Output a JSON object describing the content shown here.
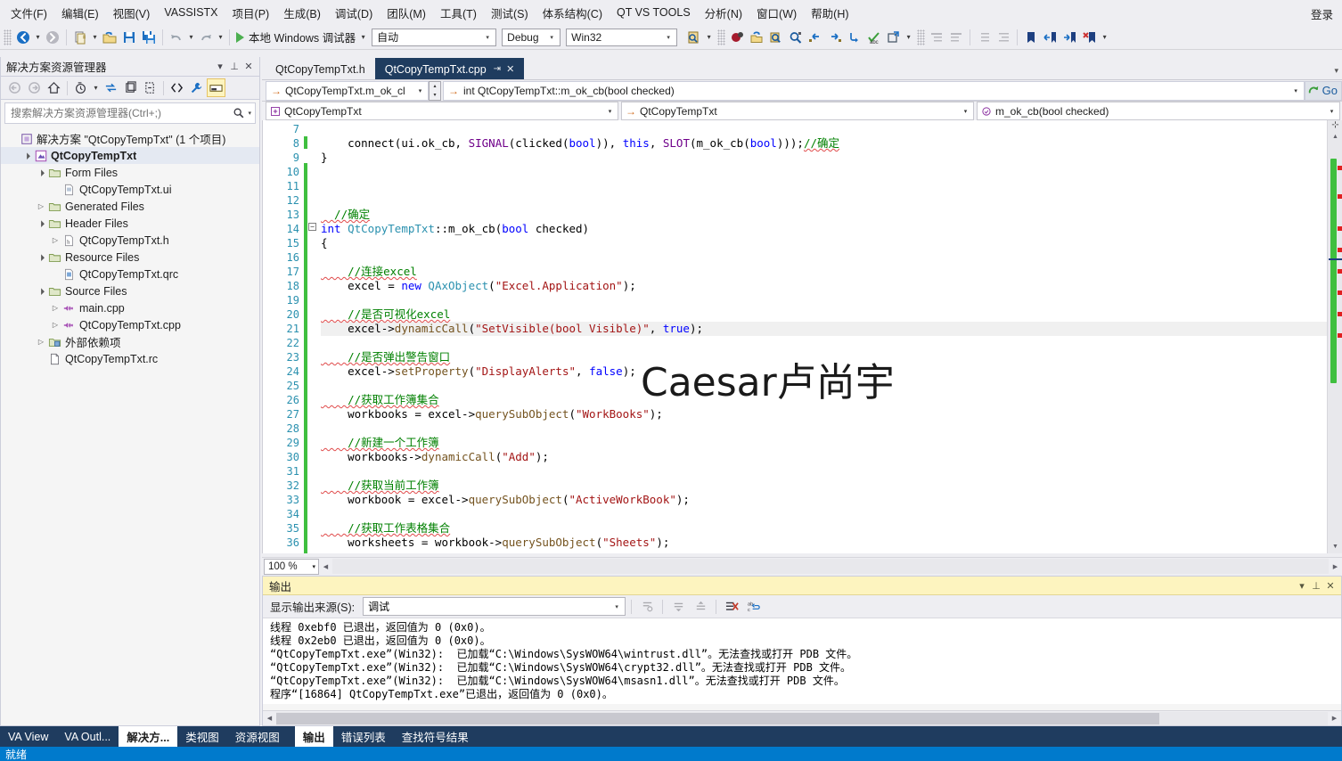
{
  "menubar": {
    "items": [
      {
        "label": "文件(F)",
        "name": "menu-file"
      },
      {
        "label": "编辑(E)",
        "name": "menu-edit"
      },
      {
        "label": "视图(V)",
        "name": "menu-view"
      },
      {
        "label": "VASSISTX",
        "name": "menu-vassistx"
      },
      {
        "label": "项目(P)",
        "name": "menu-project"
      },
      {
        "label": "生成(B)",
        "name": "menu-build"
      },
      {
        "label": "调试(D)",
        "name": "menu-debug"
      },
      {
        "label": "团队(M)",
        "name": "menu-team"
      },
      {
        "label": "工具(T)",
        "name": "menu-tools"
      },
      {
        "label": "测试(S)",
        "name": "menu-test"
      },
      {
        "label": "体系结构(C)",
        "name": "menu-architecture"
      },
      {
        "label": "QT VS TOOLS",
        "name": "menu-qt-vs-tools"
      },
      {
        "label": "分析(N)",
        "name": "menu-analyze"
      },
      {
        "label": "窗口(W)",
        "name": "menu-window"
      },
      {
        "label": "帮助(H)",
        "name": "menu-help"
      }
    ],
    "signin_label": "登录"
  },
  "toolbar": {
    "navigate_back": "navigate-backward-icon",
    "navigate_forward": "navigate-forward-icon",
    "new_project": "new-project-icon",
    "open_file": "open-file-icon",
    "save": "save-icon",
    "save_all": "save-all-icon",
    "undo": "undo-icon",
    "redo": "redo-icon",
    "run_label": "本地 Windows 调试器",
    "config_value": "自动",
    "build_config_value": "Debug",
    "platform_value": "Win32",
    "accent_green": "#4caf50"
  },
  "solution_explorer": {
    "title": "解决方案资源管理器",
    "search_placeholder": "搜索解决方案资源管理器(Ctrl+;)",
    "tree": [
      {
        "label": "解决方案 \"QtCopyTempTxt\" (1 个项目)",
        "depth": 0,
        "expander": "",
        "icon": "solution-icon",
        "bold": false,
        "name": "tree-item-solution"
      },
      {
        "label": "QtCopyTempTxt",
        "depth": 1,
        "expander": "▲",
        "icon": "project-icon",
        "bold": true,
        "name": "tree-item-project"
      },
      {
        "label": "Form Files",
        "depth": 2,
        "expander": "▲",
        "icon": "folder-icon",
        "bold": false,
        "name": "tree-item-form-files"
      },
      {
        "label": "QtCopyTempTxt.ui",
        "depth": 3,
        "expander": "",
        "icon": "ui-file-icon",
        "bold": false,
        "name": "tree-item-ui-file"
      },
      {
        "label": "Generated Files",
        "depth": 2,
        "expander": "▶",
        "icon": "folder-icon",
        "bold": false,
        "name": "tree-item-generated-files"
      },
      {
        "label": "Header Files",
        "depth": 2,
        "expander": "▲",
        "icon": "folder-icon",
        "bold": false,
        "name": "tree-item-header-files"
      },
      {
        "label": "QtCopyTempTxt.h",
        "depth": 3,
        "expander": "▶",
        "icon": "h-file-icon",
        "bold": false,
        "name": "tree-item-header-file"
      },
      {
        "label": "Resource Files",
        "depth": 2,
        "expander": "▲",
        "icon": "folder-icon",
        "bold": false,
        "name": "tree-item-resource-files"
      },
      {
        "label": "QtCopyTempTxt.qrc",
        "depth": 3,
        "expander": "",
        "icon": "qrc-file-icon",
        "bold": false,
        "name": "tree-item-qrc-file"
      },
      {
        "label": "Source Files",
        "depth": 2,
        "expander": "▲",
        "icon": "folder-icon",
        "bold": false,
        "name": "tree-item-source-files"
      },
      {
        "label": "main.cpp",
        "depth": 3,
        "expander": "▶",
        "icon": "cpp-file-icon",
        "bold": false,
        "name": "tree-item-main-cpp"
      },
      {
        "label": "QtCopyTempTxt.cpp",
        "depth": 3,
        "expander": "▶",
        "icon": "cpp-file-icon",
        "bold": false,
        "name": "tree-item-project-cpp"
      },
      {
        "label": "外部依赖项",
        "depth": 2,
        "expander": "▶",
        "icon": "external-deps-icon",
        "bold": false,
        "name": "tree-item-external-deps"
      },
      {
        "label": "QtCopyTempTxt.rc",
        "depth": 2,
        "expander": "",
        "icon": "rc-file-icon",
        "bold": false,
        "name": "tree-item-rc-file"
      }
    ]
  },
  "editor": {
    "tabs": [
      {
        "label": "QtCopyTempTxt.h",
        "active": false,
        "name": "tab-header"
      },
      {
        "label": "QtCopyTempTxt.cpp",
        "active": true,
        "pin": "⇥",
        "close": "✕",
        "name": "tab-source"
      }
    ],
    "navbar": {
      "member_combo": "QtCopyTempTxt.m_ok_cl",
      "signature": "int QtCopyTempTxt::m_ok_cb(bool checked)",
      "go_label": "Go"
    },
    "navbar2": {
      "class_combo": "QtCopyTempTxt",
      "scope_combo": "QtCopyTempTxt",
      "member_combo": "m_ok_cb(bool checked)"
    },
    "watermark": "Caesar卢尚宇",
    "zoom_level": "100 %",
    "first_line": 7,
    "lines": [
      {
        "n": 7,
        "segs": []
      },
      {
        "n": 8,
        "segs": [
          {
            "t": "    ",
            "c": ""
          },
          {
            "t": "connect",
            "c": ""
          },
          {
            "t": "(ui.ok_cb, ",
            "c": ""
          },
          {
            "t": "SIGNAL",
            "c": "mac"
          },
          {
            "t": "(clicked(",
            "c": ""
          },
          {
            "t": "bool",
            "c": "kw"
          },
          {
            "t": ")), ",
            "c": ""
          },
          {
            "t": "this",
            "c": "kw"
          },
          {
            "t": ", ",
            "c": ""
          },
          {
            "t": "SLOT",
            "c": "mac"
          },
          {
            "t": "(m_ok_cb(",
            "c": ""
          },
          {
            "t": "bool",
            "c": "kw"
          },
          {
            "t": ")));",
            "c": ""
          },
          {
            "t": "//确定",
            "c": "cm squig"
          }
        ]
      },
      {
        "n": 9,
        "segs": [
          {
            "t": "}",
            "c": ""
          }
        ]
      },
      {
        "n": 10,
        "segs": []
      },
      {
        "n": 11,
        "segs": []
      },
      {
        "n": 12,
        "segs": []
      },
      {
        "n": 13,
        "segs": [
          {
            "t": "  //确定",
            "c": "cm squig"
          }
        ]
      },
      {
        "n": 14,
        "segs": [
          {
            "t": "int",
            "c": "kw"
          },
          {
            "t": " ",
            "c": ""
          },
          {
            "t": "QtCopyTempTxt",
            "c": "cls2"
          },
          {
            "t": "::",
            "c": ""
          },
          {
            "t": "m_ok_cb",
            "c": ""
          },
          {
            "t": "(",
            "c": ""
          },
          {
            "t": "bool",
            "c": "kw"
          },
          {
            "t": " checked)",
            "c": ""
          }
        ]
      },
      {
        "n": 15,
        "segs": [
          {
            "t": "{",
            "c": ""
          }
        ]
      },
      {
        "n": 16,
        "segs": []
      },
      {
        "n": 17,
        "segs": [
          {
            "t": "    //连接excel",
            "c": "cm squig"
          }
        ]
      },
      {
        "n": 18,
        "segs": [
          {
            "t": "    excel = ",
            "c": ""
          },
          {
            "t": "new",
            "c": "kw"
          },
          {
            "t": " ",
            "c": ""
          },
          {
            "t": "QAxObject",
            "c": "cls2"
          },
          {
            "t": "(",
            "c": ""
          },
          {
            "t": "\"Excel.Application\"",
            "c": "str"
          },
          {
            "t": ");",
            "c": ""
          }
        ]
      },
      {
        "n": 19,
        "segs": []
      },
      {
        "n": 20,
        "segs": [
          {
            "t": "    //是否可视化excel",
            "c": "cm squig"
          }
        ]
      },
      {
        "n": 21,
        "segs": [
          {
            "t": "    excel->",
            "c": ""
          },
          {
            "t": "dynamicCall",
            "c": "fn"
          },
          {
            "t": "(",
            "c": ""
          },
          {
            "t": "\"SetVisible(bool Visible)\"",
            "c": "str"
          },
          {
            "t": ", ",
            "c": ""
          },
          {
            "t": "true",
            "c": "kw"
          },
          {
            "t": ");",
            "c": ""
          }
        ],
        "hl": true
      },
      {
        "n": 22,
        "segs": []
      },
      {
        "n": 23,
        "segs": [
          {
            "t": "    //是否弹出警告窗口",
            "c": "cm squig"
          }
        ]
      },
      {
        "n": 24,
        "segs": [
          {
            "t": "    excel->",
            "c": ""
          },
          {
            "t": "setProperty",
            "c": "fn"
          },
          {
            "t": "(",
            "c": ""
          },
          {
            "t": "\"DisplayAlerts\"",
            "c": "str"
          },
          {
            "t": ", ",
            "c": ""
          },
          {
            "t": "false",
            "c": "kw"
          },
          {
            "t": ");",
            "c": ""
          }
        ]
      },
      {
        "n": 25,
        "segs": []
      },
      {
        "n": 26,
        "segs": [
          {
            "t": "    //获取工作簿集合",
            "c": "cm squig"
          }
        ]
      },
      {
        "n": 27,
        "segs": [
          {
            "t": "    workbooks = excel->",
            "c": ""
          },
          {
            "t": "querySubObject",
            "c": "fn"
          },
          {
            "t": "(",
            "c": ""
          },
          {
            "t": "\"WorkBooks\"",
            "c": "str"
          },
          {
            "t": ");",
            "c": ""
          }
        ]
      },
      {
        "n": 28,
        "segs": []
      },
      {
        "n": 29,
        "segs": [
          {
            "t": "    //新建一个工作簿",
            "c": "cm squig"
          }
        ]
      },
      {
        "n": 30,
        "segs": [
          {
            "t": "    workbooks->",
            "c": ""
          },
          {
            "t": "dynamicCall",
            "c": "fn"
          },
          {
            "t": "(",
            "c": ""
          },
          {
            "t": "\"Add\"",
            "c": "str"
          },
          {
            "t": ");",
            "c": ""
          }
        ]
      },
      {
        "n": 31,
        "segs": []
      },
      {
        "n": 32,
        "segs": [
          {
            "t": "    //获取当前工作簿",
            "c": "cm squig"
          }
        ]
      },
      {
        "n": 33,
        "segs": [
          {
            "t": "    workbook = excel->",
            "c": ""
          },
          {
            "t": "querySubObject",
            "c": "fn"
          },
          {
            "t": "(",
            "c": ""
          },
          {
            "t": "\"ActiveWorkBook\"",
            "c": "str"
          },
          {
            "t": ");",
            "c": ""
          }
        ]
      },
      {
        "n": 34,
        "segs": []
      },
      {
        "n": 35,
        "segs": [
          {
            "t": "    //获取工作表格集合",
            "c": "cm squig"
          }
        ]
      },
      {
        "n": 36,
        "segs": [
          {
            "t": "    worksheets = workbook->",
            "c": ""
          },
          {
            "t": "querySubObject",
            "c": "fn"
          },
          {
            "t": "(",
            "c": ""
          },
          {
            "t": "\"Sheets\"",
            "c": "str"
          },
          {
            "t": ");",
            "c": ""
          }
        ]
      }
    ]
  },
  "output": {
    "title": "输出",
    "source_label": "显示输出来源(S):",
    "source_value": "调试",
    "lines": [
      "线程 0xebf0 已退出，返回值为 0 (0x0)。",
      "线程 0x2eb0 已退出，返回值为 0 (0x0)。",
      "“QtCopyTempTxt.exe”(Win32):  已加载“C:\\Windows\\SysWOW64\\wintrust.dll”。无法查找或打开 PDB 文件。",
      "“QtCopyTempTxt.exe”(Win32):  已加载“C:\\Windows\\SysWOW64\\crypt32.dll”。无法查找或打开 PDB 文件。",
      "“QtCopyTempTxt.exe”(Win32):  已加载“C:\\Windows\\SysWOW64\\msasn1.dll”。无法查找或打开 PDB 文件。",
      "程序“[16864] QtCopyTempTxt.exe”已退出，返回值为 0 (0x0)。"
    ]
  },
  "bottom_tabs": {
    "left": [
      {
        "label": "VA View",
        "active": false,
        "name": "bottom-tab-va-view"
      },
      {
        "label": "VA Outl...",
        "active": false,
        "name": "bottom-tab-va-outline"
      },
      {
        "label": "解决方...",
        "active": true,
        "name": "bottom-tab-solution-explorer"
      },
      {
        "label": "类视图",
        "active": false,
        "name": "bottom-tab-class-view"
      },
      {
        "label": "资源视图",
        "active": false,
        "name": "bottom-tab-resource-view"
      }
    ],
    "right": [
      {
        "label": "输出",
        "active": true,
        "name": "bottom-tab-output"
      },
      {
        "label": "错误列表",
        "active": false,
        "name": "bottom-tab-error-list"
      },
      {
        "label": "查找符号结果",
        "active": false,
        "name": "bottom-tab-find-symbol-results"
      }
    ]
  },
  "statusbar": {
    "text": "就绪",
    "color": "#007acc"
  }
}
